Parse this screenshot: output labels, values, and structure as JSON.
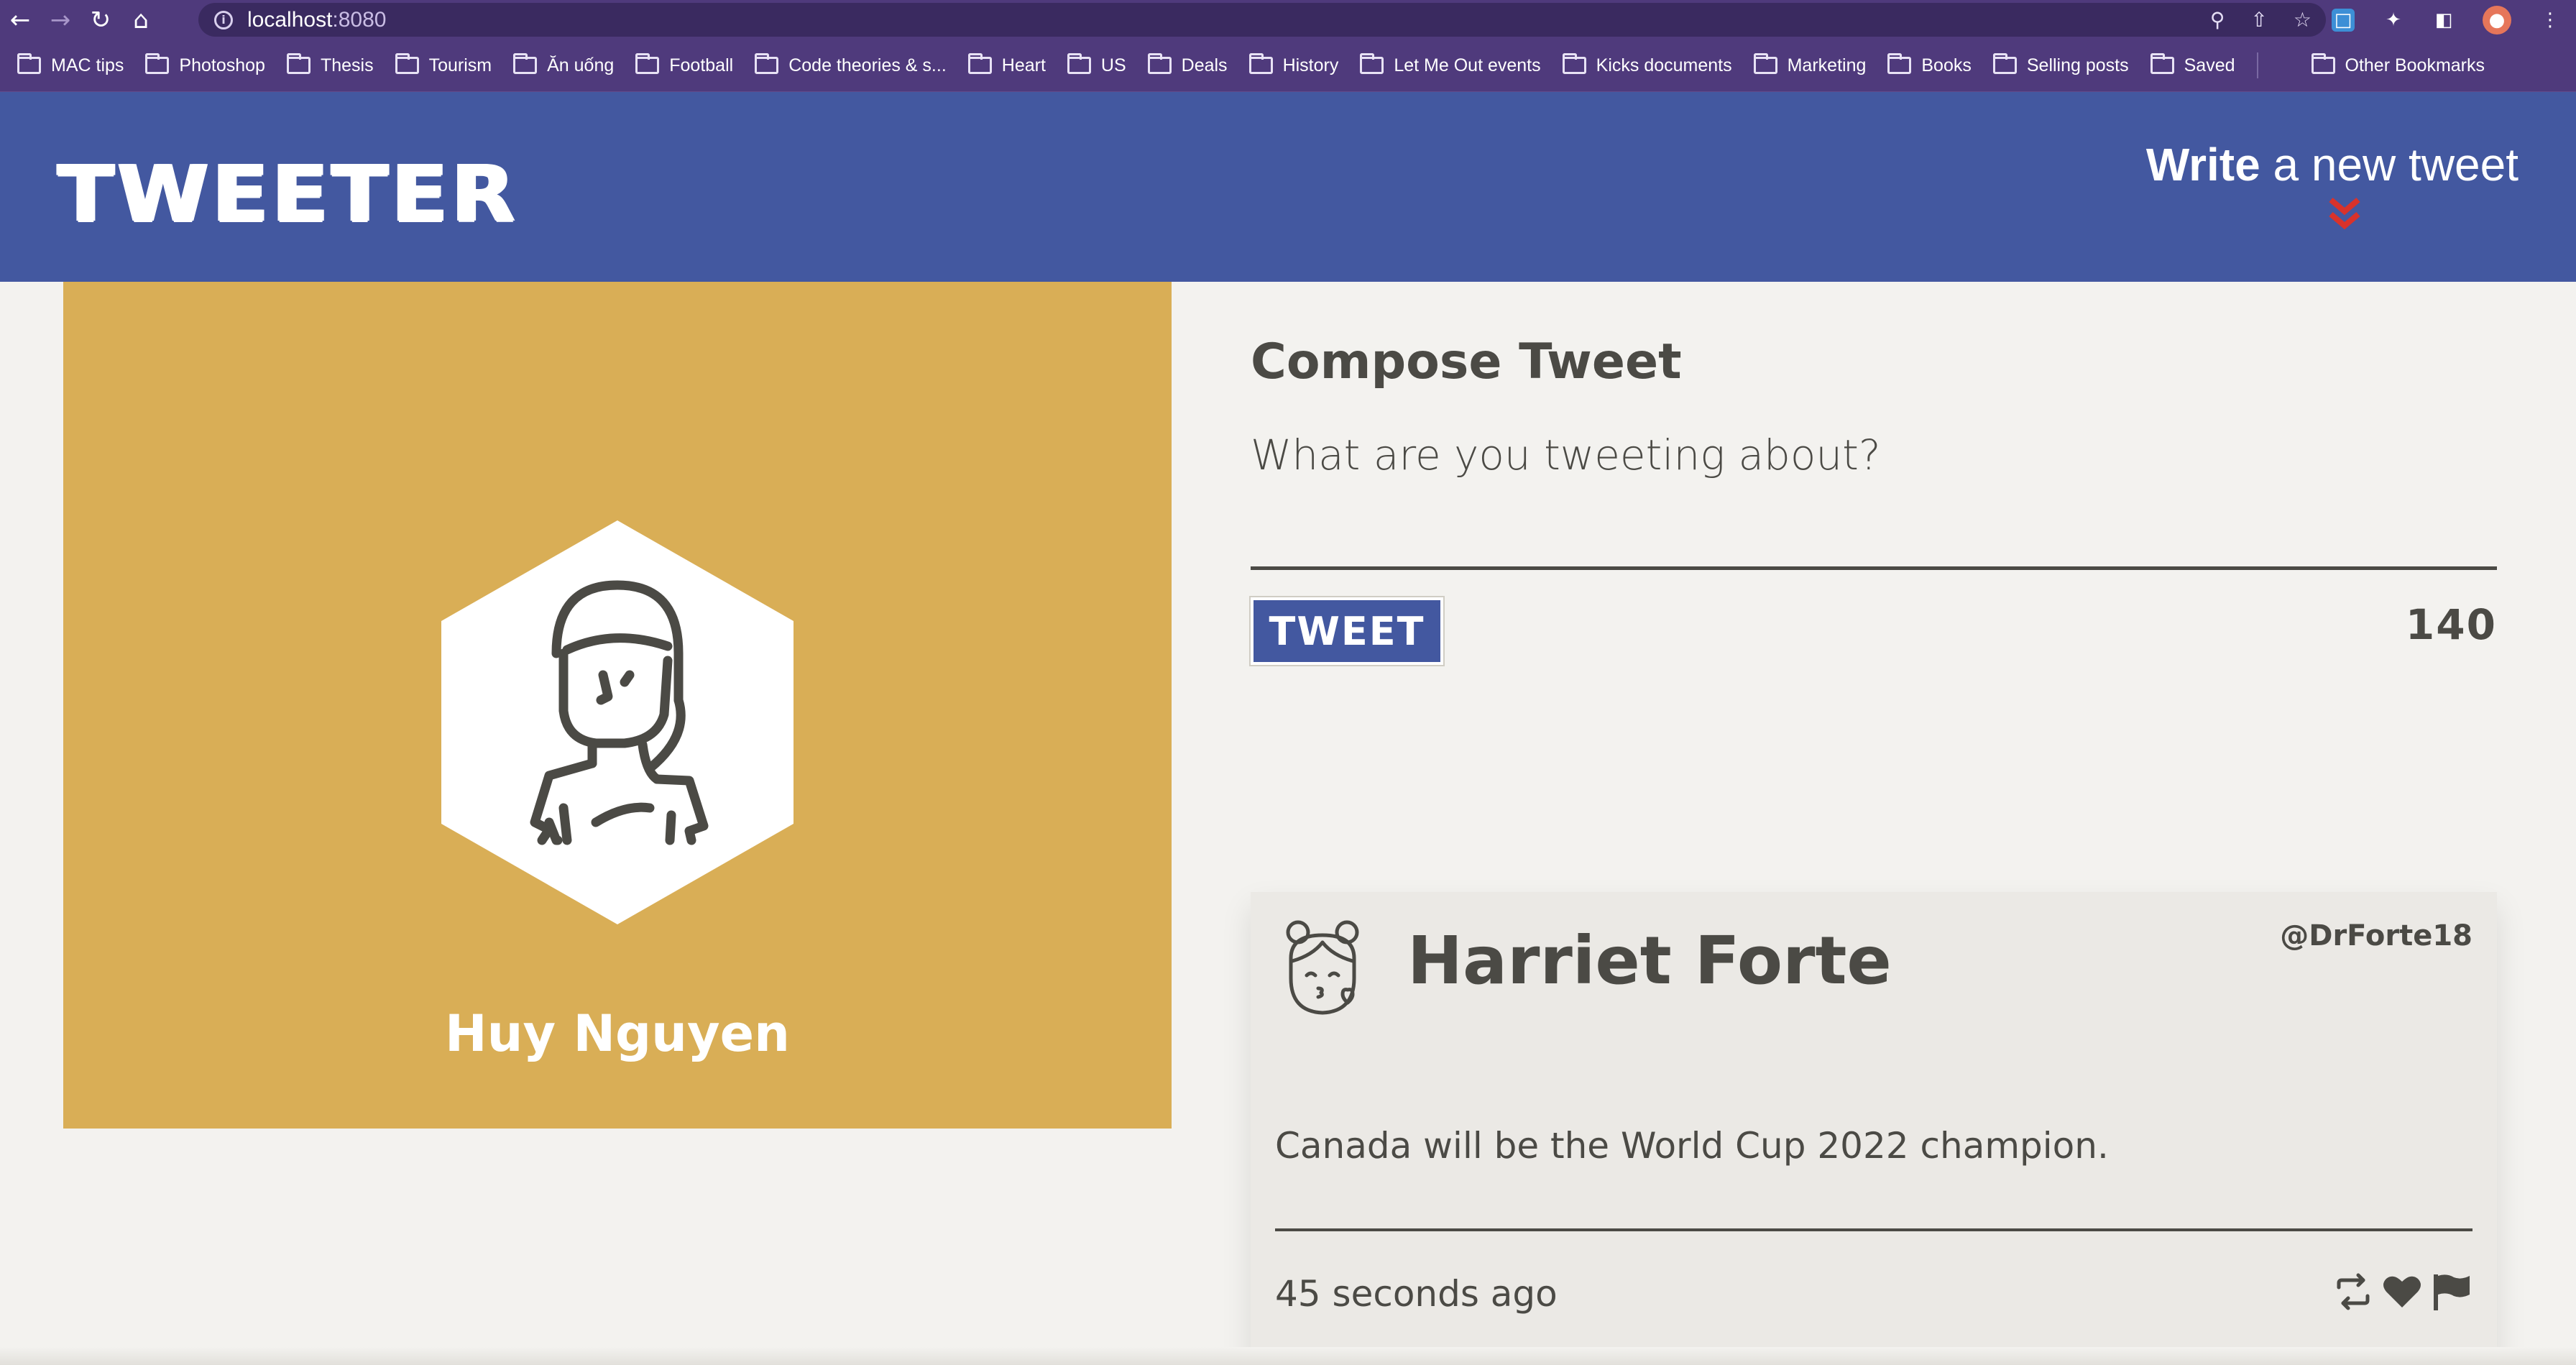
{
  "browser": {
    "url_host": "localhost",
    "url_port": ":8080",
    "bookmarks": [
      "MAC tips",
      "Photoshop",
      "Thesis",
      "Tourism",
      "Ăn uống",
      "Football",
      "Code theories & s...",
      "Heart",
      "US",
      "Deals",
      "History",
      "Let Me Out events",
      "Kicks documents",
      "Marketing",
      "Books",
      "Selling posts",
      "Saved"
    ],
    "other_bookmarks": "Other Bookmarks"
  },
  "header": {
    "brand": "TWEETER",
    "write_bold": "Write",
    "write_rest": " a new tweet",
    "accent_color": "#d9322b"
  },
  "profile": {
    "name": "Huy Nguyen",
    "background_color": "#d9ae56"
  },
  "compose": {
    "title": "Compose Tweet",
    "placeholder": "What are you tweeting about?",
    "button_label": "TWEET",
    "counter": "140"
  },
  "tweets": [
    {
      "name": "Harriet Forte",
      "handle": "@DrForte18",
      "text": "Canada will be the World Cup 2022 champion.",
      "time": "45 seconds ago"
    }
  ],
  "colors": {
    "brand_blue": "#4358a0",
    "chrome_purple": "#4f3a7c",
    "text_dark": "#4b4a45",
    "page_bg": "#f3f2ef"
  }
}
